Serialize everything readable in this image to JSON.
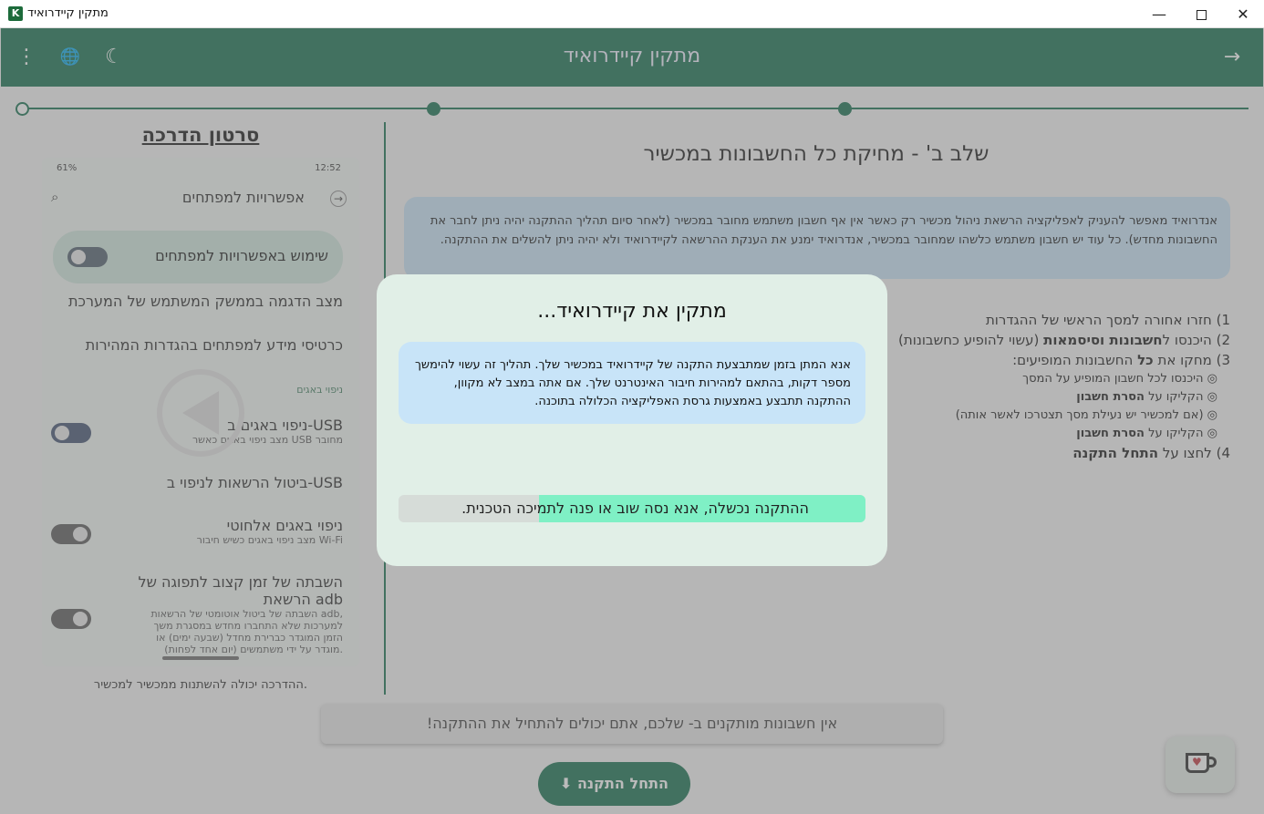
{
  "window": {
    "title": "מתקין קיידרואיד",
    "icon_letter": "K",
    "minimize": "—",
    "close": "✕"
  },
  "appbar": {
    "title": "מתקין קיידרואיד",
    "menu_icon": "⋮",
    "language_icon": "🌐",
    "theme_icon": "☾",
    "forward_icon": "→"
  },
  "tutorial": {
    "title": "סרטון הדרכה",
    "caption": "ההדרכה יכולה להשתנות ממכשיר למכשיר.",
    "phone": {
      "battery": "61%",
      "time": "12:52",
      "screen_title": "אפשרויות למפתחים",
      "main_toggle_label": "שימוש באפשרויות למפתחים",
      "rows": [
        {
          "title": "מצב הדגמה בממשק המשתמש של המערכת",
          "subtitle": ""
        },
        {
          "title": "כרטיסי מידע למפתחים בהגדרות המהירות",
          "subtitle": ""
        },
        {
          "title": "ניפוי באגים ב-USB",
          "subtitle": "מצב ניפוי באגים כאשר USB מחובר"
        },
        {
          "title": "ביטול הרשאות לניפוי ב-USB",
          "subtitle": ""
        },
        {
          "title": "ניפוי באגים אלחוטי",
          "subtitle": "מצב ניפוי באגים כשיש חיבור Wi-Fi"
        },
        {
          "title": "השבתה של זמן קצוב לתפוגה של הרשאת adb",
          "subtitle": "השבתה של ביטול אוטומטי של הרשאות adb, למערכות שלא התחברו מחדש במסגרת משך הזמן המוגדר כברירת מחדל (שבעה ימים) או מוגדר על ידי משתמשים (יום אחד לפחות)."
        }
      ],
      "section_label": "ניפוי באגים"
    }
  },
  "step": {
    "title": "שלב ב' - מחיקת כל החשבונות במכשיר",
    "info": "אנדרואיד מאפשר להעניק לאפליקציה הרשאת ניהול מכשיר רק כאשר אין אף חשבון משתמש מחובר במכשיר (לאחר סיום תהליך ההתקנה יהיה ניתן לחבר את החשבונות מחדש). כל עוד יש חשבון משתמש כלשהו שמחובר במכשיר, אנדרואיד ימנע את הענקת ההרשאה לקיידרואיד ולא יהיה ניתן להשלים את ההתקנה.",
    "lines": [
      {
        "prefix": "1) ",
        "text": "חזרו אחורה למסך הראשי של ההגדרות",
        "bold": "",
        "suffix": ""
      },
      {
        "prefix": "2) ",
        "text": "היכנסו ל",
        "bold": "חשבונות וסיסמאות",
        "suffix": " (עשוי להופיע כחשבונות)"
      },
      {
        "prefix": "3) ",
        "text": "מחקו את ",
        "bold": "כל",
        "suffix": " החשבונות המופיעים:"
      }
    ],
    "sublines": [
      {
        "text": "◎ היכנסו לכל חשבון המופיע על המסך",
        "bold": ""
      },
      {
        "text": "◎ הקליקו על ",
        "bold": "הסרת חשבון"
      },
      {
        "text": "◎ (אם למכשיר יש נעילת מסך תצטרכו לאשר אותה)",
        "bold": ""
      },
      {
        "text": "◎ הקליקו על ",
        "bold": "הסרת חשבון"
      }
    ],
    "last": {
      "prefix": "4) ",
      "text": "לחצו על ",
      "bold": "התחל התקנה"
    }
  },
  "notice": "אין חשבונות מותקנים ב- שלכם, אתם יכולים להתחיל את ההתקנה!",
  "start_button": "התחל התקנה",
  "start_icon": "⬇",
  "dialog": {
    "title": "מתקין את קיידרואיד...",
    "info": "אנא המתן בזמן שמתבצעת התקנה של קיידרואיד במכשיר שלך. תהליך זה עשוי להימשך מספר דקות, בהתאם למהירות חיבור האינטרנט שלך. אם אתה במצב לא מקוון, ההתקנה תתבצע באמצעות גרסת האפליקציה הכלולה בתוכנה.",
    "progress_fraction": 0.7,
    "progress_text": "ההתקנה נכשלה, אנא נסה שוב או פנה לתמיכה הטכנית."
  },
  "colors": {
    "primary": "#0d6b48",
    "progress_fill": "#7ff0c5",
    "info_bg": "#c8e4f8"
  }
}
